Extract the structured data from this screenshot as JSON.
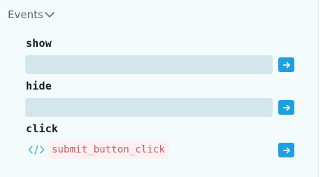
{
  "section": {
    "title": "Events",
    "expanded": true
  },
  "events": [
    {
      "label": "show",
      "value": "",
      "placeholder": ""
    },
    {
      "label": "hide",
      "value": "",
      "placeholder": ""
    },
    {
      "label": "click",
      "handler": "submit_button_click"
    }
  ],
  "colors": {
    "panel_background": "#f3fbfd",
    "input_background": "#d2e6eb",
    "button_accent": "#1fa0de",
    "handler_text": "#d4536a",
    "handler_background": "#fdf0f3",
    "code_icon": "#4aa8d8"
  },
  "icons": {
    "expand": "chevron-down-icon",
    "go": "arrow-right-icon",
    "code": "code-icon"
  }
}
